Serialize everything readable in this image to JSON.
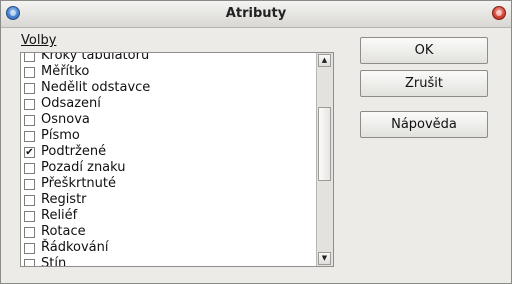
{
  "window": {
    "title": "Atributy"
  },
  "options_label": "Volby",
  "items": [
    {
      "label": "Kroky tabulátoru",
      "checked": false
    },
    {
      "label": "Měřítko",
      "checked": false
    },
    {
      "label": "Nedělit odstavce",
      "checked": false
    },
    {
      "label": "Odsazení",
      "checked": false
    },
    {
      "label": "Osnova",
      "checked": false
    },
    {
      "label": "Písmo",
      "checked": false
    },
    {
      "label": "Podtržené",
      "checked": true
    },
    {
      "label": "Pozadí znaku",
      "checked": false
    },
    {
      "label": "Přeškrtnuté",
      "checked": false
    },
    {
      "label": "Registr",
      "checked": false
    },
    {
      "label": "Reliéf",
      "checked": false
    },
    {
      "label": "Rotace",
      "checked": false
    },
    {
      "label": "Řádkování",
      "checked": false
    },
    {
      "label": "Stín",
      "checked": false
    }
  ],
  "buttons": {
    "ok": "OK",
    "cancel": "Zrušit",
    "help": "Nápověda"
  },
  "check_mark": "✔",
  "scroll_up_arrow": "▲",
  "scroll_down_arrow": "▼"
}
